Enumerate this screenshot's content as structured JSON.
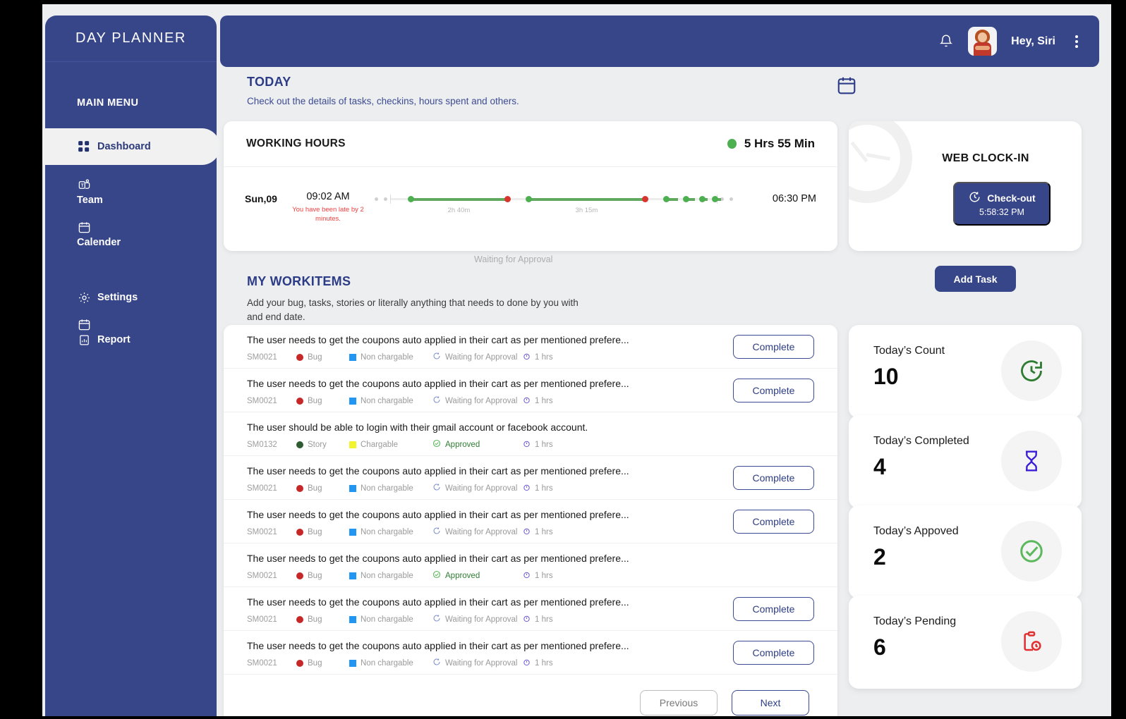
{
  "app": {
    "brand": "DAY PLANNER"
  },
  "sidebar": {
    "menu_title": "MAIN MENU",
    "items": [
      {
        "label": "Dashboard",
        "icon": "grid-icon",
        "active": true
      },
      {
        "label": "Team",
        "icon": "team-icon",
        "active": false
      },
      {
        "label": "Calender",
        "icon": "calendar-icon",
        "active": false
      },
      {
        "label": "Settings",
        "icon": "gear-icon",
        "active": false
      },
      {
        "label": "Report",
        "icon": "report-icon",
        "active": false
      }
    ]
  },
  "topbar": {
    "bell_icon": "bell-icon",
    "avatar_icon": "user-avatar",
    "greeting": "Hey, Siri",
    "menu_icon": "kebab-menu-icon"
  },
  "today": {
    "title": "TODAY",
    "subtitle": "Check out the details of tasks, checkins, hours spent and others.",
    "calendar_icon": "calendar-icon"
  },
  "working_hours": {
    "title": "WORKING HOURS",
    "total": "5 Hrs 55 Min",
    "status_color": "#4caf50",
    "day": "Sun,09",
    "check_in": "09:02 AM",
    "late_note": "You have been  late by 2 minutes.",
    "check_out": "06:30 PM",
    "segments": [
      {
        "label": "2h 40m",
        "start_pct": 6,
        "end_pct": 36
      },
      {
        "label": "3h 15m",
        "start_pct": 42,
        "end_pct": 78
      },
      {
        "label": "",
        "start_pct": 84,
        "end_pct": 88
      },
      {
        "label": "",
        "start_pct": 90,
        "end_pct": 93
      },
      {
        "label": "",
        "start_pct": 95,
        "end_pct": 97
      },
      {
        "label": "",
        "start_pct": 99,
        "end_pct": 101
      }
    ]
  },
  "clock_in": {
    "title": "WEB CLOCK-IN",
    "button_label": "Check-out",
    "button_time": "5:58:32 PM",
    "button_icon": "clock-rotate-icon",
    "accent": "#374589"
  },
  "workitems": {
    "floating_note": "Waiting for Approval",
    "title": "MY WORKITEMS",
    "subtitle": "Add your bug, tasks, stories or literally anything that needs to done by you with and end date.",
    "add_task_label": "Add Task",
    "complete_label": "Complete",
    "rows": [
      {
        "text": "The user needs to get the coupons auto applied in their cart as per mentioned prefere...",
        "id": "SM0021",
        "type": "Bug",
        "type_color": "#c62828",
        "type_shape": "circle",
        "charge": "Non chargable",
        "charge_color": "#2196f3",
        "status": "Waiting for Approval",
        "status_state": "waiting",
        "hours": "1 hrs",
        "has_button": true
      },
      {
        "text": "The user needs to get the coupons auto applied in their cart as per mentioned prefere...",
        "id": "SM0021",
        "type": "Bug",
        "type_color": "#c62828",
        "type_shape": "circle",
        "charge": "Non chargable",
        "charge_color": "#2196f3",
        "status": "Waiting for Approval",
        "status_state": "waiting",
        "hours": "1 hrs",
        "has_button": true
      },
      {
        "text": "The user should be able to login with their gmail account or facebook account.",
        "id": "SM0132",
        "type": "Story",
        "type_color": "#2e5b32",
        "type_shape": "circle",
        "charge": "Chargable",
        "charge_color": "#f2f52e",
        "status": "Approved",
        "status_state": "approved",
        "hours": "1 hrs",
        "has_button": false
      },
      {
        "text": "The user needs to get the coupons auto applied in their cart as per mentioned prefere...",
        "id": "SM0021",
        "type": "Bug",
        "type_color": "#c62828",
        "type_shape": "circle",
        "charge": "Non chargable",
        "charge_color": "#2196f3",
        "status": "Waiting for Approval",
        "status_state": "waiting",
        "hours": "1 hrs",
        "has_button": true
      },
      {
        "text": "The user needs to get the coupons auto applied in their cart as per mentioned prefere...",
        "id": "SM0021",
        "type": "Bug",
        "type_color": "#c62828",
        "type_shape": "circle",
        "charge": "Non chargable",
        "charge_color": "#2196f3",
        "status": "Waiting for Approval",
        "status_state": "waiting",
        "hours": "1 hrs",
        "has_button": true
      },
      {
        "text": "The user needs to get the coupons auto applied in their cart as per mentioned prefere...",
        "id": "SM0021",
        "type": "Bug",
        "type_color": "#c62828",
        "type_shape": "circle",
        "charge": "Non chargable",
        "charge_color": "#2196f3",
        "status": "Approved",
        "status_state": "approved",
        "hours": "1 hrs",
        "has_button": false
      },
      {
        "text": "The user needs to get the coupons auto applied in their cart as per mentioned prefere...",
        "id": "SM0021",
        "type": "Bug",
        "type_color": "#c62828",
        "type_shape": "circle",
        "charge": "Non chargable",
        "charge_color": "#2196f3",
        "status": "Waiting for Approval",
        "status_state": "waiting",
        "hours": "1 hrs",
        "has_button": true
      },
      {
        "text": "The user needs to get the coupons auto applied in their cart as per mentioned prefere...",
        "id": "SM0021",
        "type": "Bug",
        "type_color": "#c62828",
        "type_shape": "circle",
        "charge": "Non chargable",
        "charge_color": "#2196f3",
        "status": "Waiting for Approval",
        "status_state": "waiting",
        "hours": "1 hrs",
        "has_button": true
      }
    ],
    "pagination": {
      "previous": "Previous",
      "next": "Next"
    }
  },
  "stats": [
    {
      "label": "Today’s  Count",
      "value": "10",
      "icon": "clock-history-icon",
      "icon_color": "#2e7d32"
    },
    {
      "label": "Today’s Completed",
      "value": "4",
      "icon": "hourglass-icon",
      "icon_color": "#3b1fd6"
    },
    {
      "label": "Today’s Appoved",
      "value": "2",
      "icon": "check-circle-icon",
      "icon_color": "#5cb85c"
    },
    {
      "label": "Today’s Pending",
      "value": "6",
      "icon": "clipboard-clock-icon",
      "icon_color": "#e03030"
    }
  ]
}
